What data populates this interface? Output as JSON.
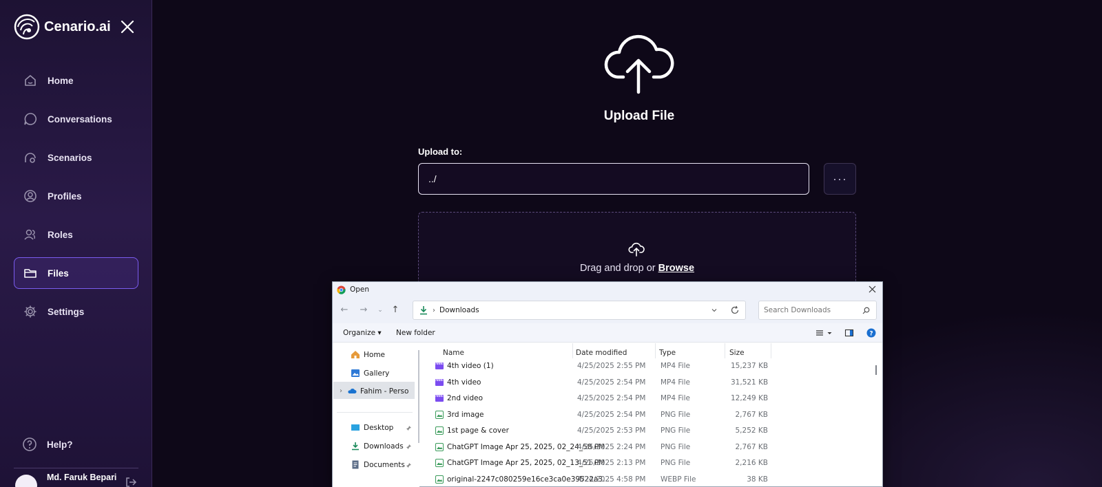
{
  "sidebar": {
    "brand": "Cenario.ai",
    "items": [
      {
        "label": "Home",
        "icon": "home-icon"
      },
      {
        "label": "Conversations",
        "icon": "chat-bubble-icon"
      },
      {
        "label": "Scenarios",
        "icon": "scenario-icon"
      },
      {
        "label": "Profiles",
        "icon": "profile-icon"
      },
      {
        "label": "Roles",
        "icon": "roles-icon"
      },
      {
        "label": "Files",
        "icon": "folder-icon",
        "active": true
      },
      {
        "label": "Settings",
        "icon": "gear-icon"
      }
    ],
    "help": "Help?",
    "user_name": "Md. Faruk Bepari"
  },
  "main": {
    "title": "Upload File",
    "upload_to_label": "Upload to:",
    "path_value": "../",
    "more_label": "···",
    "drop_text": "Drag and drop or",
    "browse": "Browse"
  },
  "dialog": {
    "title": "Open",
    "address": "Downloads",
    "search_placeholder": "Search Downloads",
    "toolbar": {
      "organize": "Organize ▾",
      "new_folder": "New folder"
    },
    "tree": [
      "Home",
      "Gallery",
      "Fahim - Persona",
      "Desktop",
      "Downloads",
      "Documents"
    ],
    "columns": [
      "Name",
      "Date modified",
      "Type",
      "Size"
    ],
    "rows": [
      {
        "name": "4th video (1)",
        "date": "4/25/2025 2:55 PM",
        "type": "MP4 File",
        "size": "15,237 KB",
        "kind": "video"
      },
      {
        "name": "4th video",
        "date": "4/25/2025 2:54 PM",
        "type": "MP4 File",
        "size": "31,521 KB",
        "kind": "video"
      },
      {
        "name": "2nd video",
        "date": "4/25/2025 2:54 PM",
        "type": "MP4 File",
        "size": "12,249 KB",
        "kind": "video"
      },
      {
        "name": "3rd image",
        "date": "4/25/2025 2:54 PM",
        "type": "PNG File",
        "size": "2,767 KB",
        "kind": "image"
      },
      {
        "name": "1st page & cover",
        "date": "4/25/2025 2:53 PM",
        "type": "PNG File",
        "size": "5,252 KB",
        "kind": "image"
      },
      {
        "name": "ChatGPT Image Apr 25, 2025, 02_24_58 PM",
        "date": "4/25/2025 2:24 PM",
        "type": "PNG File",
        "size": "2,767 KB",
        "kind": "image"
      },
      {
        "name": "ChatGPT Image Apr 25, 2025, 02_13_51 PM",
        "date": "4/25/2025 2:13 PM",
        "type": "PNG File",
        "size": "2,216 KB",
        "kind": "image"
      },
      {
        "name": "original-2247c080259e16ce3ca0e39522a3...",
        "date": "4/24/2025 4:58 PM",
        "type": "WEBP File",
        "size": "38 KB",
        "kind": "image"
      }
    ]
  }
}
